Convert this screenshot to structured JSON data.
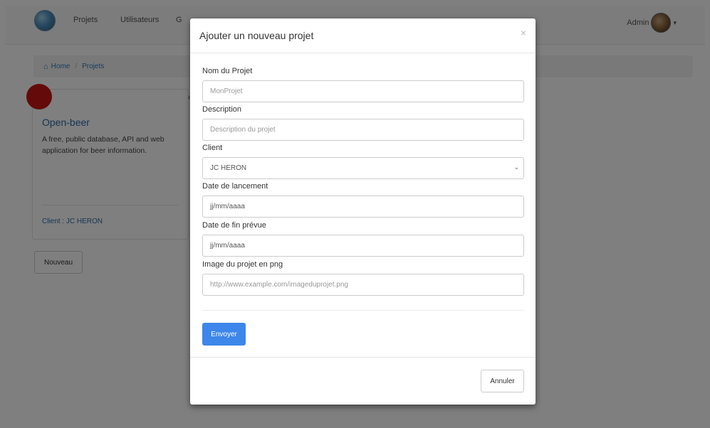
{
  "navbar": {
    "links": [
      "Projets",
      "Utilisateurs",
      "G"
    ],
    "admin_label": "Admin",
    "caret_icon": "▾"
  },
  "breadcrumb": {
    "home_icon": "⌂",
    "home": "Home",
    "separator": "/",
    "current": "Projets"
  },
  "project_card": {
    "title": "Open-beer",
    "description": "A free, public database, API and web application for beer information.",
    "client": "Client : JC HERON"
  },
  "page_actions": {
    "new_label": "Nouveau"
  },
  "modal": {
    "title": "Ajouter un nouveau projet",
    "close_glyph": "×",
    "fields": {
      "name": {
        "label": "Nom du Projet",
        "placeholder": "MonProjet"
      },
      "description": {
        "label": "Description",
        "placeholder": "Description du projet"
      },
      "client": {
        "label": "Client",
        "value": "JC HERON",
        "chevron": "⌄"
      },
      "start_date": {
        "label": "Date de lancement",
        "value": "jj/mm/aaaa"
      },
      "end_date": {
        "label": "Date de fin prévue",
        "value": "jj/mm/aaaa"
      },
      "image": {
        "label": "Image du projet en png",
        "placeholder": "http://www.example.com/imageduprojet.png"
      }
    },
    "submit_label": "Envoyer",
    "cancel_label": "Annuler"
  },
  "colors": {
    "primary_button": "#3d86ea",
    "link_blue": "#2c6aa8",
    "badge_red": "#c91414",
    "overlay": "rgba(0,0,0,0.5)"
  }
}
